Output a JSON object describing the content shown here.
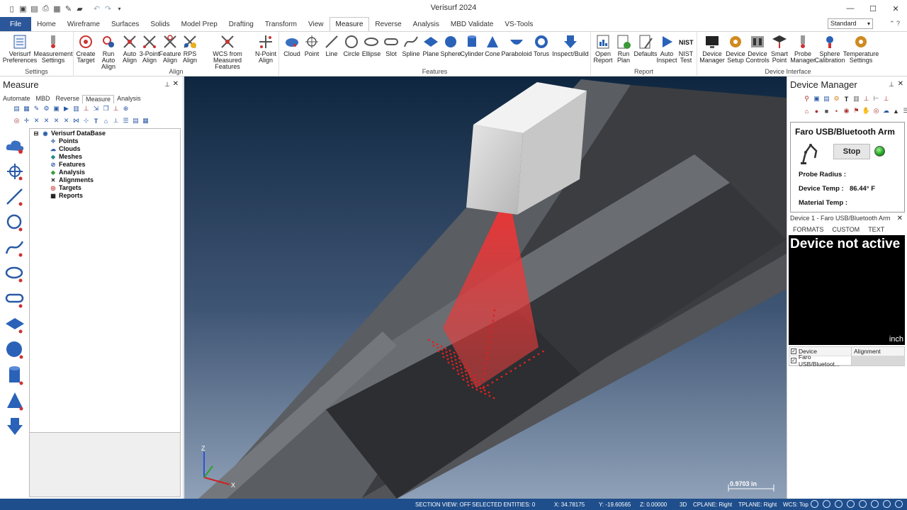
{
  "app": {
    "title": "Verisurf 2024"
  },
  "ribbon_tabs": [
    {
      "label": "File"
    },
    {
      "label": "Home"
    },
    {
      "label": "Wireframe"
    },
    {
      "label": "Surfaces"
    },
    {
      "label": "Solids"
    },
    {
      "label": "Model Prep"
    },
    {
      "label": "Drafting"
    },
    {
      "label": "Transform"
    },
    {
      "label": "View"
    },
    {
      "label": "Measure"
    },
    {
      "label": "Reverse"
    },
    {
      "label": "Analysis"
    },
    {
      "label": "MBD Validate"
    },
    {
      "label": "VS-Tools"
    }
  ],
  "active_tab": "Measure",
  "view_select": {
    "value": "Standard"
  },
  "ribbon": {
    "settings": {
      "label": "Settings",
      "buttons": [
        [
          "Verisurf",
          "Preferences"
        ],
        [
          "Measurement",
          "Settings"
        ]
      ]
    },
    "align": {
      "label": "Align",
      "buttons": [
        [
          "Create",
          "Target"
        ],
        [
          "Run Auto",
          "Align"
        ],
        [
          "Auto",
          "Align"
        ],
        [
          "3-Point",
          "Align"
        ],
        [
          "Feature",
          "Align"
        ],
        [
          "RPS",
          "Align"
        ],
        [
          "WCS from",
          "Measured Features"
        ],
        [
          "N-Point",
          "Align"
        ]
      ]
    },
    "features": {
      "label": "Features",
      "buttons": [
        "Cloud",
        "Point",
        "Line",
        "Circle",
        "Ellipse",
        "Slot",
        "Spline",
        "Plane",
        "Sphere",
        "Cylinder",
        "Cone",
        "Paraboloid",
        "Torus"
      ]
    },
    "inspect": {
      "buttons": [
        [
          "Inspect/Build",
          ""
        ]
      ]
    },
    "report": {
      "label": "Report",
      "buttons": [
        [
          "Open",
          "Report"
        ],
        [
          "Run",
          "Plan"
        ],
        [
          "Defaults",
          ""
        ],
        [
          "Auto",
          "Inspect"
        ],
        [
          "NIST",
          "Test"
        ]
      ]
    },
    "device": {
      "label": "Device Interface",
      "buttons": [
        [
          "Device",
          "Manager"
        ],
        [
          "Device",
          "Setup"
        ],
        [
          "Device",
          "Controls"
        ],
        [
          "Smart",
          "Point"
        ],
        [
          "Probe",
          "Manager"
        ],
        [
          "Sphere",
          "Calibration"
        ],
        [
          "Temperature",
          "Settings"
        ]
      ]
    }
  },
  "left_panel": {
    "title": "Measure",
    "tabs": [
      "Automate",
      "MBD",
      "Reverse",
      "Measure",
      "Analysis"
    ],
    "active_tab": "Measure",
    "tree": {
      "root": "Verisurf DataBase",
      "children": [
        "Points",
        "Clouds",
        "Meshes",
        "Features",
        "Analysis",
        "Alignments",
        "Targets",
        "Reports"
      ]
    }
  },
  "viewport": {
    "axis_z": "Z",
    "axis_x": "X",
    "scale": "0.9703 in"
  },
  "right_panel": {
    "title": "Device Manager",
    "device_name": "Faro USB/Bluetooth Arm",
    "stop_label": "Stop",
    "probe_radius_label": "Probe Radius :",
    "device_temp_label": "Device Temp :",
    "device_temp_value": "86.44° F",
    "material_temp_label": "Material Temp :",
    "sub_title": "Device 1 - Faro USB/Bluetooth Arm",
    "formats": [
      "FORMATS",
      "CUSTOM",
      "TEXT"
    ],
    "screen_text": "Device not active",
    "screen_units": "inch",
    "table_headers": [
      "Device",
      "Alignment"
    ],
    "table_rows": [
      [
        "Faro USB/Bluetoot...",
        ""
      ]
    ]
  },
  "status_bar": {
    "section_view": "SECTION VIEW: OFF",
    "selected": "SELECTED ENTITIES: 0",
    "x": "X:   34.78175",
    "y": "Y:   -19.60565",
    "z": "Z:   0.00000",
    "mode": "3D",
    "cplane": "CPLANE: Right",
    "tplane": "TPLANE: Right",
    "wcs": "WCS: Top"
  },
  "colors": {
    "accent": "#2b579a",
    "statusbar": "#1f4e8c",
    "laser": "#e02020"
  }
}
